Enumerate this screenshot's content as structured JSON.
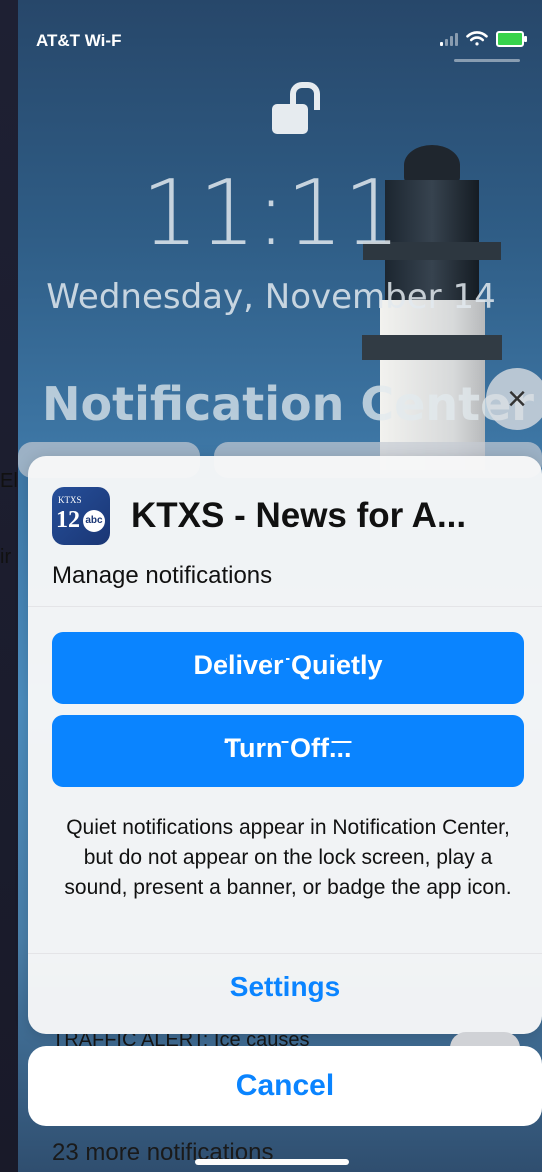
{
  "status_bar": {
    "carrier": "AT&T Wi-F",
    "signal_bars": 4,
    "wifi_icon": "wifi-icon",
    "battery_icon": "battery-charging-icon",
    "battery_color": "#37d34c"
  },
  "lock_screen": {
    "lock_icon": "unlocked-padlock-icon",
    "time": "11:11",
    "date": "Wednesday, November 14",
    "notification_center_title": "Notification Center",
    "close_icon": "close-icon"
  },
  "background_fragments": {
    "left_1": "El",
    "left_2": "ir",
    "traffic_alert": "TRAFFIC ALERT: Ice causes"
  },
  "modal": {
    "app_icon": {
      "name": "ktxs-12-abc-icon",
      "top_text": "KTXS",
      "number": "12",
      "network": "abc"
    },
    "app_name": "KTXS - News for A...",
    "subtitle": "Manage notifications",
    "buttons": {
      "deliver_quietly": "Deliver Quietly",
      "turn_off": "Turn Off..."
    },
    "description": "Quiet notifications appear in Notification Center, but do not appear on the lock screen, play a sound, present a banner, or badge the app icon.",
    "settings": "Settings"
  },
  "actions": {
    "cancel": "Cancel"
  },
  "footer": {
    "more_notifications": "23 more notifications"
  },
  "colors": {
    "accent_blue": "#0a84ff",
    "sheet_bg": "#f8f8f8"
  }
}
